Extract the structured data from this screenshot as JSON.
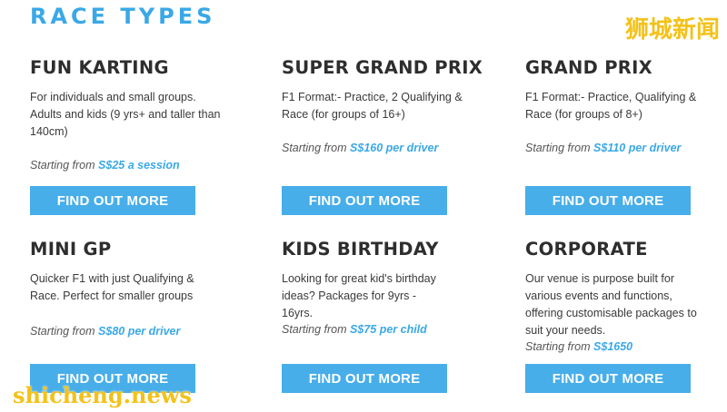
{
  "section_title": "RACE TYPES",
  "watermarks": {
    "top": "狮城新闻",
    "bottom": "shicheng.news"
  },
  "cards": [
    {
      "title": "FUN KARTING",
      "description": "For individuals and small groups. Adults and kids (9 yrs+ and taller than 140cm)",
      "price_prefix": "Starting from ",
      "price_value": "S$25 a session",
      "button": "FIND OUT MORE"
    },
    {
      "title": "SUPER GRAND PRIX",
      "description": "F1 Format:- Practice, 2 Qualifying & Race (for groups of 16+)",
      "price_prefix": "Starting from ",
      "price_value": "S$160 per driver",
      "button": "FIND OUT MORE"
    },
    {
      "title": "GRAND PRIX",
      "description": "F1 Format:- Practice, Qualifying & Race (for groups of 8+)",
      "price_prefix": "Starting from ",
      "price_value": "S$110 per driver",
      "button": "FIND OUT MORE"
    },
    {
      "title": "MINI GP",
      "description": "Quicker F1 with just Qualifying & Race. Perfect for smaller groups",
      "price_prefix": "Starting from ",
      "price_value": "S$80 per driver",
      "button": "FIND OUT MORE"
    },
    {
      "title": "KIDS BIRTHDAY",
      "description": "Looking for great kid's birthday ideas? Packages for 9yrs - 16yrs.",
      "price_prefix": "Starting from ",
      "price_value": "S$75 per child",
      "button": "FIND OUT MORE"
    },
    {
      "title": "CORPORATE",
      "description": "Our venue is purpose built for various events and functions, offering customisable packages to suit your needs.",
      "price_prefix": "Starting from ",
      "price_value": "S$1650",
      "button": "FIND OUT MORE"
    }
  ],
  "colors": {
    "accent": "#3aa8e6",
    "button": "#47aee9",
    "watermark": "#f3c21a"
  }
}
